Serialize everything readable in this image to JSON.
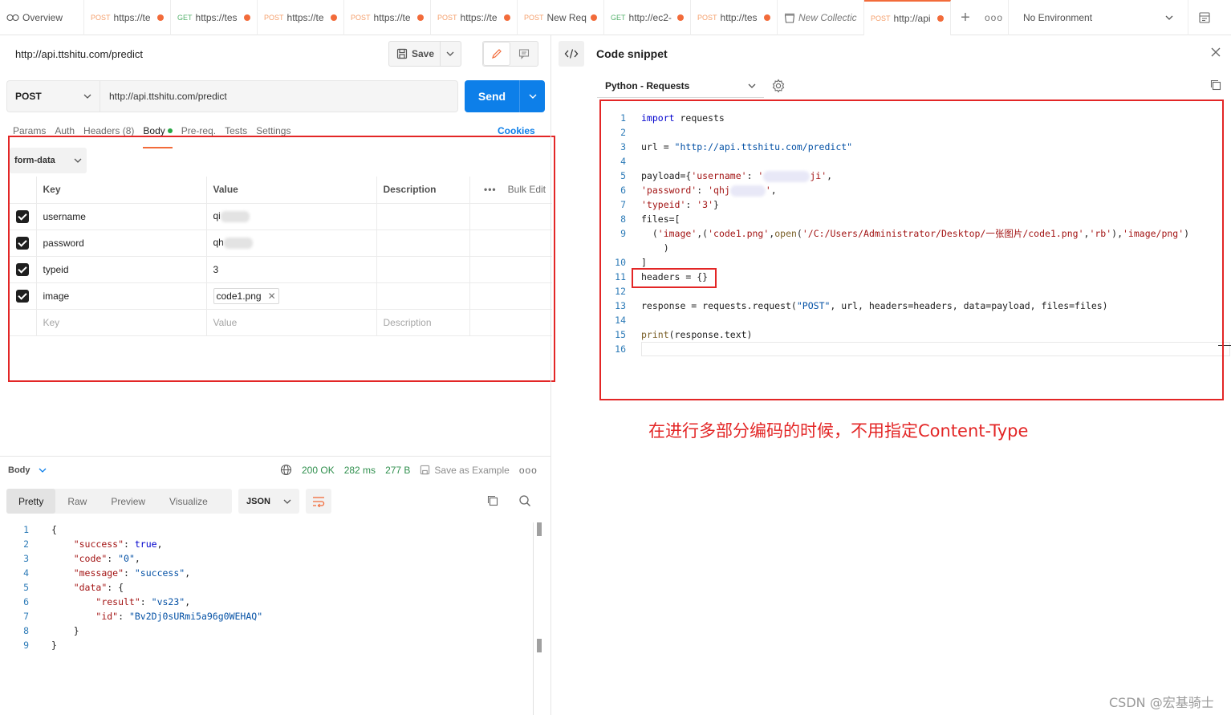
{
  "tabs": [
    {
      "kind": "overview",
      "label": "Overview"
    },
    {
      "kind": "request",
      "method": "POST",
      "label": "https://te",
      "dot": true
    },
    {
      "kind": "request",
      "method": "GET",
      "label": "https://tes",
      "dot": true
    },
    {
      "kind": "request",
      "method": "POST",
      "label": "https://te",
      "dot": true
    },
    {
      "kind": "request",
      "method": "POST",
      "label": "https://te",
      "dot": true
    },
    {
      "kind": "request",
      "method": "POST",
      "label": "https://te",
      "dot": true
    },
    {
      "kind": "request",
      "method": "POST",
      "label": "New Req",
      "dot": true
    },
    {
      "kind": "request",
      "method": "GET",
      "label": "http://ec2-",
      "dot": true
    },
    {
      "kind": "request",
      "method": "POST",
      "label": "http://tes",
      "dot": true
    },
    {
      "kind": "collection",
      "label": "New Collectic"
    },
    {
      "kind": "request",
      "method": "POST",
      "label": "http://api",
      "dot": true,
      "active": true
    }
  ],
  "environment": "No Environment",
  "request": {
    "title": "http://api.ttshitu.com/predict",
    "save_label": "Save",
    "method": "POST",
    "url": "http://api.ttshitu.com/predict",
    "send_label": "Send",
    "subtabs": {
      "params": "Params",
      "auth": "Auth",
      "headers": "Headers (8)",
      "body": "Body",
      "prereq": "Pre-req.",
      "tests": "Tests",
      "settings": "Settings"
    },
    "cookies": "Cookies",
    "body_mode": "form-data",
    "table": {
      "headers": {
        "key": "Key",
        "value": "Value",
        "description": "Description",
        "bulk_edit": "Bulk Edit"
      },
      "rows": [
        {
          "key": "username",
          "value": "qi",
          "checked": true
        },
        {
          "key": "password",
          "value": "qh",
          "checked": true
        },
        {
          "key": "typeid",
          "value": "3",
          "checked": true
        },
        {
          "key": "image",
          "value": "code1.png",
          "checked": true,
          "file": true
        }
      ],
      "placeholder": {
        "key": "Key",
        "value": "Value",
        "description": "Description"
      }
    }
  },
  "response": {
    "section_label": "Body",
    "status": "200 OK",
    "time": "282 ms",
    "size": "277 B",
    "save_example": "Save as Example",
    "view_tabs": [
      "Pretty",
      "Raw",
      "Preview",
      "Visualize"
    ],
    "format": "JSON",
    "lines": [
      {
        "n": "1",
        "html": "{"
      },
      {
        "n": "2",
        "html": "    <span class='k'>\"success\"</span>: <span class='b'>true</span>,"
      },
      {
        "n": "3",
        "html": "    <span class='k'>\"code\"</span>: <span class='s'>\"0\"</span>,"
      },
      {
        "n": "4",
        "html": "    <span class='k'>\"message\"</span>: <span class='s'>\"success\"</span>,"
      },
      {
        "n": "5",
        "html": "    <span class='k'>\"data\"</span>: {"
      },
      {
        "n": "6",
        "html": "        <span class='k'>\"result\"</span>: <span class='s'>\"vs23\"</span>,"
      },
      {
        "n": "7",
        "html": "        <span class='k'>\"id\"</span>: <span class='s'>\"Bv2Dj0sURmi5a96g0WEHAQ\"</span>"
      },
      {
        "n": "8",
        "html": "    }"
      },
      {
        "n": "9",
        "html": "}"
      }
    ]
  },
  "snippet": {
    "title": "Code snippet",
    "language": "Python - Requests",
    "lines": [
      {
        "n": "1",
        "html": "<span class='kw'>import</span> requests"
      },
      {
        "n": "2",
        "html": ""
      },
      {
        "n": "3",
        "html": "url = <span class='str'>\"http://api.ttshitu.com/predict\"</span>"
      },
      {
        "n": "4",
        "html": ""
      },
      {
        "n": "5",
        "html": "payload={<span class='st2'>'username'</span>: <span class='st2'>'</span><span class='fblur'></span><span class='st2'>ji'</span>,"
      },
      {
        "n": "6",
        "html": "<span class='st2'>'password'</span>: <span class='st2'>'qhj</span><span class='fblur' style='width:44px'></span><span class='st2'>'</span>,"
      },
      {
        "n": "7",
        "html": "<span class='st2'>'typeid'</span>: <span class='st2'>'3'</span>}"
      },
      {
        "n": "8",
        "html": "files=["
      },
      {
        "n": "9",
        "html": "  (<span class='st2'>'image'</span>,(<span class='st2'>'code1.png'</span>,<span class='pf'>open</span>(<span class='st2'>'/C:/Users/Administrator/Desktop/一张图片/code1.png'</span>,<span class='st2'>'rb'</span>),<span class='st2'>'image/png'</span>)"
      },
      {
        "n": "",
        "html": "    )"
      },
      {
        "n": "10",
        "html": "]"
      },
      {
        "n": "11",
        "html": "headers = {}"
      },
      {
        "n": "12",
        "html": ""
      },
      {
        "n": "13",
        "html": "response = requests.request(<span class='str'>\"POST\"</span>, url, headers=headers, data=payload, files=files)"
      },
      {
        "n": "14",
        "html": ""
      },
      {
        "n": "15",
        "html": "<span class='pf'>print</span>(response.text)"
      },
      {
        "n": "16",
        "html": ""
      }
    ]
  },
  "annotation": "在进行多部分编码的时候，不用指定Content-Type",
  "watermark": "CSDN @宏基骑士",
  "colors": {
    "accent": "#f26b3a",
    "send": "#0d7fe9",
    "highlight": "#e32626",
    "status_ok": "#2f8f4d"
  }
}
